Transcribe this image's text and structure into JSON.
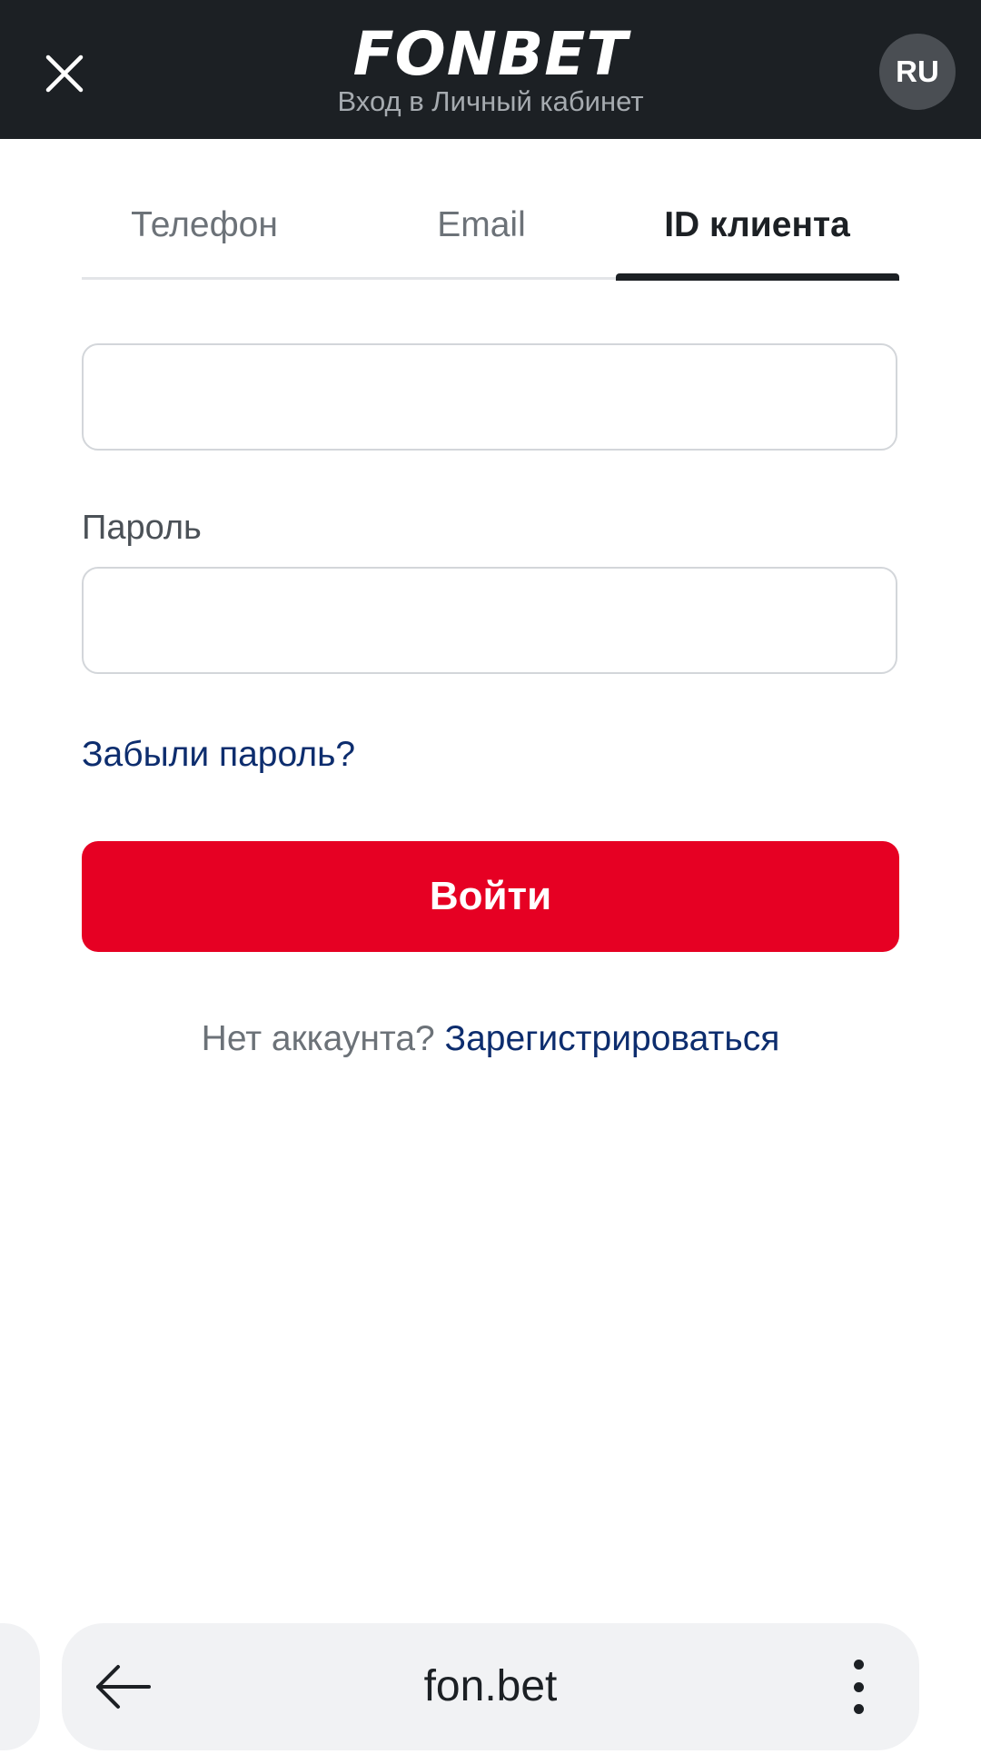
{
  "header": {
    "logo": "FONBET",
    "subtitle": "Вход в Личный кабинет",
    "language": "RU",
    "background_color": "#1c2024"
  },
  "tabs": [
    {
      "label": "Телефон",
      "active": false
    },
    {
      "label": "Email",
      "active": false
    },
    {
      "label": "ID клиента",
      "active": true
    }
  ],
  "form": {
    "client_id_value": "",
    "password_label": "Пароль",
    "password_value": "",
    "forgot_password": "Забыли пароль?",
    "login_button": "Войти",
    "login_button_color": "#e60023",
    "no_account": "Нет аккаунта?",
    "register_link": "Зарегистрироваться",
    "link_color": "#0d2d6e"
  },
  "browser": {
    "url": "fon.bet"
  }
}
